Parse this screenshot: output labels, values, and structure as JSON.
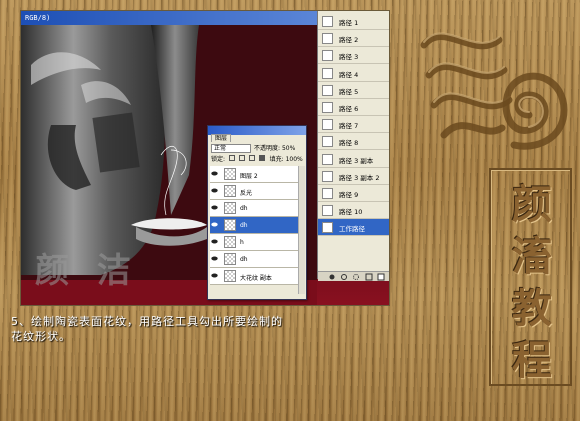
{
  "screenshot": {
    "title": "RGB/8)",
    "canvas_text": "颜 洁",
    "layers_panel": {
      "tab": "图层",
      "blend_mode": "正常",
      "opacity_label": "不透明度:",
      "opacity_value": "50%",
      "lock_label": "锁定:",
      "fill_label": "填充:",
      "fill_value": "100%",
      "layers": [
        {
          "name": "图层 2",
          "selected": false
        },
        {
          "name": "反光",
          "selected": false
        },
        {
          "name": "dh",
          "selected": false
        },
        {
          "name": "dh",
          "selected": true
        },
        {
          "name": "h",
          "selected": false
        },
        {
          "name": "dh",
          "selected": false
        },
        {
          "name": "大花纹 副本",
          "selected": false
        }
      ]
    },
    "paths_panel": {
      "items": [
        {
          "name": "路径 1",
          "selected": false
        },
        {
          "name": "路径 2",
          "selected": false
        },
        {
          "name": "路径 3",
          "selected": false
        },
        {
          "name": "路径 4",
          "selected": false
        },
        {
          "name": "路径 5",
          "selected": false
        },
        {
          "name": "路径 6",
          "selected": false
        },
        {
          "name": "路径 7",
          "selected": false
        },
        {
          "name": "路径 8",
          "selected": false
        },
        {
          "name": "路径 3 副本",
          "selected": false
        },
        {
          "name": "路径 3 副本 2",
          "selected": false
        },
        {
          "name": "路径 9",
          "selected": false
        },
        {
          "name": "路径 10",
          "selected": false
        },
        {
          "name": "工作路径",
          "selected": true
        }
      ]
    }
  },
  "caption": {
    "line1": "5、绘制陶瓷表面花纹，用路径工具勾出所要绘制的",
    "line2": "花纹形状。"
  },
  "branding": {
    "chars": [
      "颜",
      "滀",
      "教",
      "程"
    ]
  }
}
